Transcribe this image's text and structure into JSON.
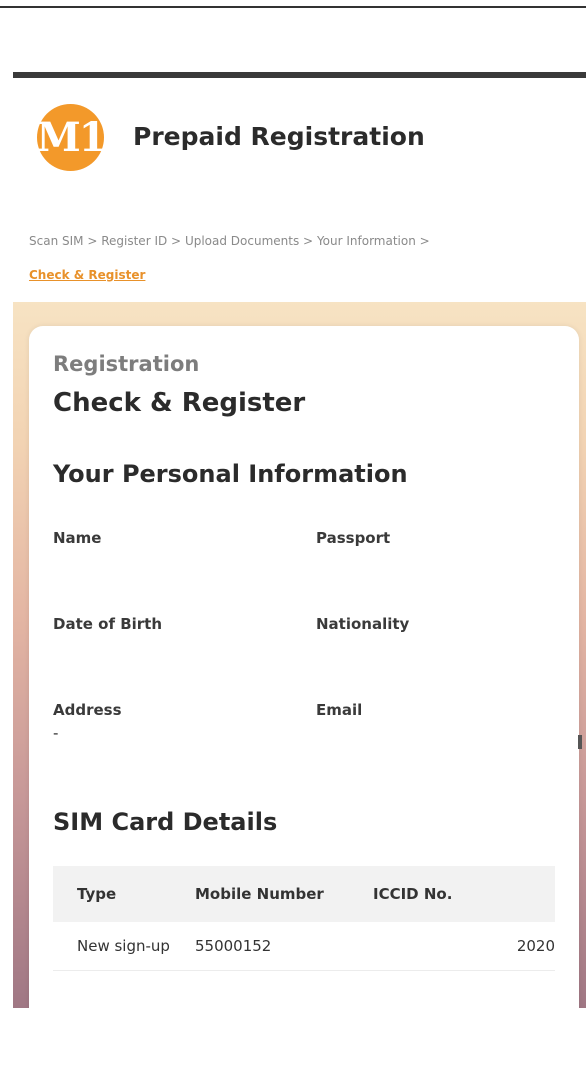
{
  "header": {
    "logo_text": "M1",
    "title": "Prepaid Registration"
  },
  "breadcrumb": {
    "steps": [
      "Scan SIM",
      "Register ID",
      "Upload Documents",
      "Your Information"
    ],
    "separator": ">",
    "current": "Check & Register"
  },
  "card": {
    "subtitle": "Registration",
    "title": "Check & Register",
    "personal": {
      "heading": "Your Personal Information",
      "name_label": "Name",
      "passport_label": "Passport",
      "dob_label": "Date of Birth",
      "nationality_label": "Nationality",
      "address_label": "Address",
      "address_value": "-",
      "email_label": "Email"
    },
    "sim": {
      "heading": "SIM Card Details",
      "columns": [
        "Type",
        "Mobile Number",
        "ICCID No."
      ],
      "rows": [
        {
          "type": "New sign-up",
          "mobile": "55000152",
          "iccid": "2020"
        }
      ]
    }
  }
}
